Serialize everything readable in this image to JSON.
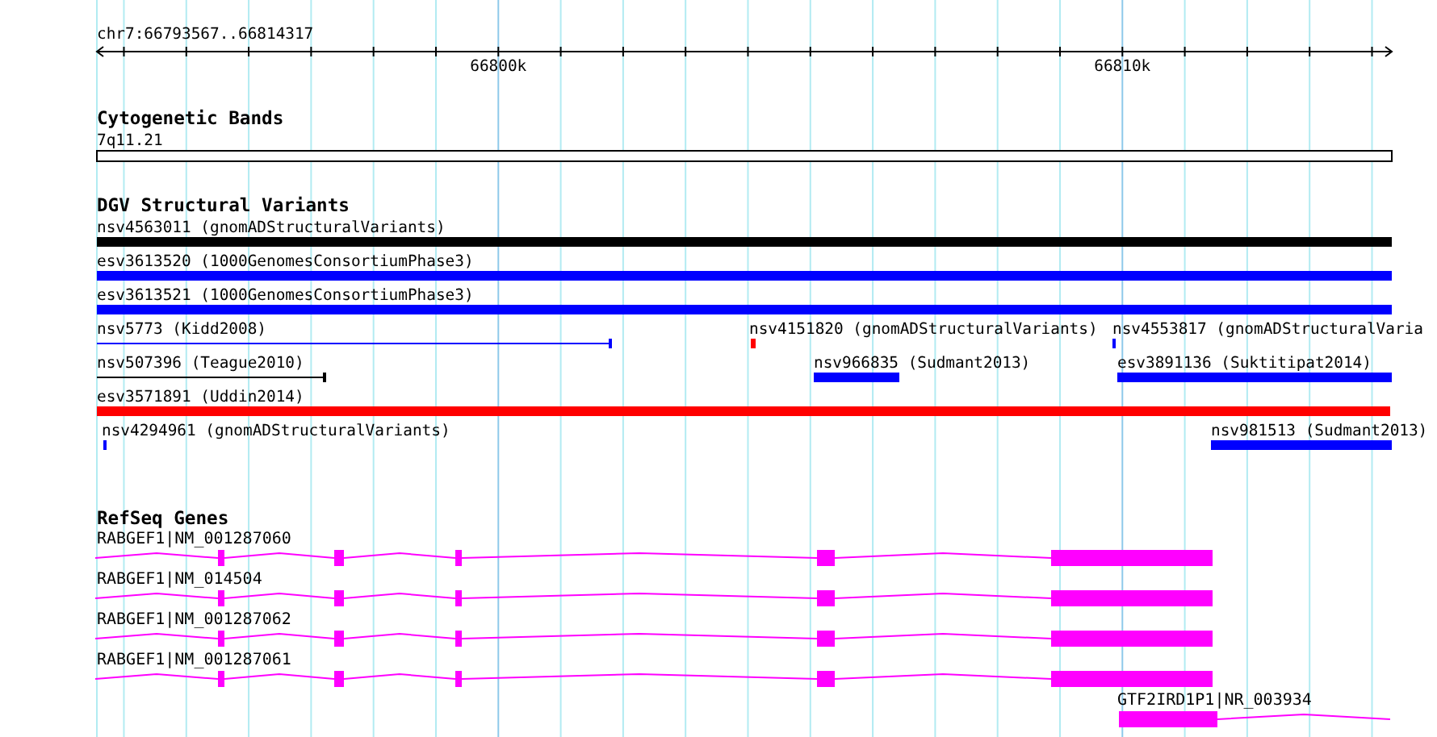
{
  "ruler": {
    "location": "chr7:66793567..66814317",
    "tick_labels": [
      "66800k",
      "66810k"
    ]
  },
  "cytogenetic_bands": {
    "title": "Cytogenetic Bands",
    "band": "7q11.21"
  },
  "dgv": {
    "title": "DGV Structural Variants",
    "rows": [
      {
        "features": [
          {
            "label": "nsv4563011 (gnomADStructuralVariants)",
            "kind": "bar",
            "color": "#000000"
          }
        ]
      },
      {
        "features": [
          {
            "label": "esv3613520 (1000GenomesConsortiumPhase3)",
            "kind": "bar",
            "color": "#0000ff"
          }
        ]
      },
      {
        "features": [
          {
            "label": "esv3613521 (1000GenomesConsortiumPhase3)",
            "kind": "bar",
            "color": "#0000ff"
          }
        ]
      },
      {
        "features": [
          {
            "label": "nsv5773 (Kidd2008)",
            "kind": "line",
            "color": "#0000ff"
          },
          {
            "label": "nsv4151820 (gnomADStructuralVariants)",
            "kind": "mark",
            "color": "#ff0000"
          },
          {
            "label": "nsv4553817 (gnomADStructuralVaria",
            "kind": "mark",
            "color": "#0000ff"
          }
        ]
      },
      {
        "features": [
          {
            "label": "nsv507396 (Teague2010)",
            "kind": "line",
            "color": "#000000"
          },
          {
            "label": "nsv966835 (Sudmant2013)",
            "kind": "bar",
            "color": "#0000ff"
          },
          {
            "label": "esv3891136 (Suktitipat2014)",
            "kind": "bar",
            "color": "#0000ff"
          }
        ]
      },
      {
        "features": [
          {
            "label": "esv3571891 (Uddin2014)",
            "kind": "bar",
            "color": "#ff0000"
          }
        ]
      },
      {
        "features": [
          {
            "label": "nsv4294961 (gnomADStructuralVariants)",
            "kind": "mark",
            "color": "#0000ff"
          },
          {
            "label": "nsv981513 (Sudmant2013)",
            "kind": "bar",
            "color": "#0000ff"
          }
        ]
      }
    ]
  },
  "refseq": {
    "title": "RefSeq Genes",
    "genes": [
      {
        "label": "RABGEF1|NM_001287060"
      },
      {
        "label": "RABGEF1|NM_014504"
      },
      {
        "label": "RABGEF1|NM_001287062"
      },
      {
        "label": "RABGEF1|NM_001287061"
      },
      {
        "label": "GTF2IRD1P1|NR_003934"
      }
    ]
  }
}
